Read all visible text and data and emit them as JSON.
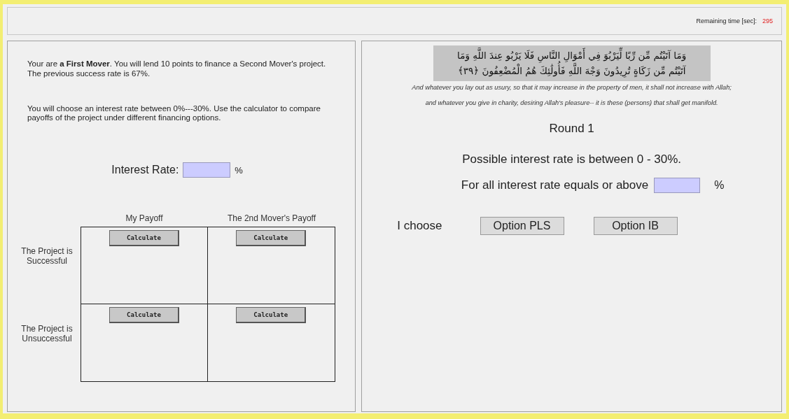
{
  "timer": {
    "label": "Remaining time [sec]:",
    "value": "295"
  },
  "left": {
    "intro": "Your are **a First Mover**. You will lend 10 points to finance a Second Mover's project. The previous success rate is 67%.",
    "instructions": "You will choose an interest rate between 0%---30%. Use the calculator to compare payoffs of the project under different financing options.",
    "interest": {
      "label": "Interest Rate:",
      "unit": "%"
    },
    "table": {
      "columns": [
        "My Payoff",
        "The 2nd Mover's Payoff"
      ],
      "rows": [
        {
          "label": "The Project is Successful",
          "buttons": [
            "Calculate",
            "Calculate"
          ]
        },
        {
          "label": "The Project is Unsuccessful",
          "buttons": [
            "Calculate",
            "Calculate"
          ]
        }
      ]
    }
  },
  "right": {
    "verse_lines": [
      "وَمَا آتَيْتُم مِّن رِّبًا لِّيَرْبُوَ فِي أَمْوَالِ النَّاسِ فَلَا يَرْبُو عِندَ اللَّهِ وَمَا",
      "آتَيْتُم مِّن زَكَاةٍ تُرِيدُونَ وَجْهَ اللَّهِ فَأُولَٰئِكَ هُمُ الْمُضْعِفُونَ ﴿٣٩﴾"
    ],
    "translation": [
      "And whatever you lay out as usury, so that it may increase in the property of men, it shall not increase with Allah;",
      "and whatever you give in charity, desiring Allah's pleasure-- it is these (persons) that shall get manifold."
    ],
    "round": "Round 1",
    "range": "Possible interest rate is between 0 - 30%.",
    "threshold": {
      "label": "For all interest rate equals or above",
      "unit": "%"
    },
    "choose": {
      "label": "I choose",
      "options": [
        "Option PLS",
        "Option IB"
      ]
    }
  }
}
